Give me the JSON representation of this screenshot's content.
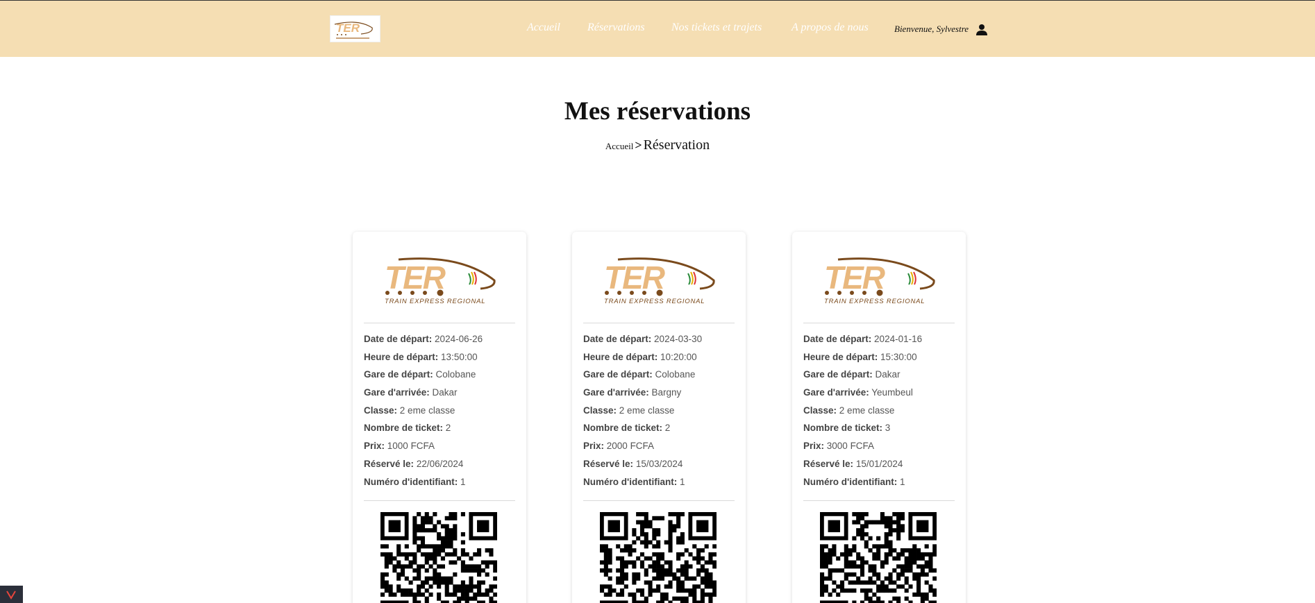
{
  "header": {
    "nav": [
      {
        "id": "accueil",
        "label": "Accueil"
      },
      {
        "id": "reservations",
        "label": "Réservations"
      },
      {
        "id": "tickets",
        "label": "Nos tickets et trajets"
      },
      {
        "id": "apropos",
        "label": "A propos de nous"
      }
    ],
    "welcome": "Bienvenue, Sylvestre"
  },
  "page": {
    "title": "Mes réservations",
    "breadcrumb": {
      "home": "Accueil",
      "separator": ">",
      "current": "Réservation"
    }
  },
  "labels": {
    "date": "Date de départ:",
    "heure": "Heure de départ:",
    "gare_dep": "Gare de départ:",
    "gare_arr": "Gare d'arrivée:",
    "classe": "Classe:",
    "nombre": "Nombre de ticket:",
    "prix": "Prix:",
    "reserve": "Réservé le:",
    "numero": "Numéro d'identifiant:"
  },
  "logo": {
    "brand": "TER",
    "tagline": "TRAIN EXPRESS REGIONAL"
  },
  "reservations": [
    {
      "date": "2024-06-26",
      "heure": "13:50:00",
      "gare_dep": "Colobane",
      "gare_arr": "Dakar",
      "classe": "2 eme classe",
      "nombre": "2",
      "prix": "1000 FCFA",
      "reserve": "22/06/2024",
      "numero": "1"
    },
    {
      "date": "2024-03-30",
      "heure": "10:20:00",
      "gare_dep": "Colobane",
      "gare_arr": "Bargny",
      "classe": "2 eme classe",
      "nombre": "2",
      "prix": "2000 FCFA",
      "reserve": "15/03/2024",
      "numero": "1"
    },
    {
      "date": "2024-01-16",
      "heure": "15:30:00",
      "gare_dep": "Dakar",
      "gare_arr": "Yeumbeul",
      "classe": "2 eme classe",
      "nombre": "3",
      "prix": "3000 FCFA",
      "reserve": "15/01/2024",
      "numero": "1"
    }
  ],
  "colors": {
    "header_bg": "#f5deb3",
    "logo_orange": "#e9b87e",
    "logo_brown": "#7a4a1c"
  }
}
